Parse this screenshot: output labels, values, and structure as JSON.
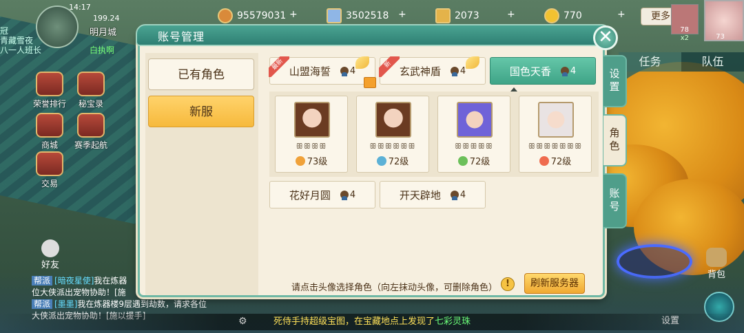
{
  "status": {
    "time": "14:17",
    "distance": "199.24",
    "city": "明月城"
  },
  "side_names": [
    "冠",
    "青藏雪夜",
    "八一人班长"
  ],
  "side_green": "白执啊",
  "resources": [
    {
      "icon": "copper-coin-icon",
      "value": "95579031",
      "color": "#d98a3a"
    },
    {
      "icon": "silver-note-icon",
      "value": "3502518",
      "color": "#8fb6e6"
    },
    {
      "icon": "gold-scroll-icon",
      "value": "2073",
      "color": "#e4b34a"
    },
    {
      "icon": "gold-ingot-icon",
      "value": "770",
      "color": "#f2c231"
    }
  ],
  "more_label": "更多",
  "levels": {
    "small": "78",
    "large": "73",
    "x2": "x2"
  },
  "left_menu": [
    {
      "label": "荣誉排行",
      "icon": "honor-rank-icon"
    },
    {
      "label": "秘宝录",
      "icon": "treasure-book-icon"
    },
    {
      "label": "商城",
      "icon": "shop-icon"
    },
    {
      "label": "赛季起航",
      "icon": "season-icon"
    },
    {
      "label": "交易",
      "icon": "trade-icon"
    }
  ],
  "friend_label": "好友",
  "chat": [
    {
      "tag": "帮派",
      "name": "[暗夜星使]",
      "text": "我在炼器"
    },
    {
      "tag": "",
      "name": "",
      "text": "位大侠派出宠物协助！[施"
    },
    {
      "tag": "帮派",
      "name": "[墨墨]",
      "text": "我在炼器楼9层遇到劫数，请求各位"
    },
    {
      "tag": "",
      "name": "",
      "text": "大侠派出宠物协助！[施以援手]"
    }
  ],
  "task_tabs": [
    "任务",
    "队伍"
  ],
  "bag_label": "背包",
  "settings_label": "设置",
  "announcement": {
    "main": "死侍手持超级宝图，在宝藏地点上发现了",
    "highlight": "七彩灵珠"
  },
  "dialog": {
    "title": "账号管理",
    "left_buttons": [
      "已有角色",
      "新服"
    ],
    "servers_row1": [
      {
        "name": "山盟海誓",
        "count": "4",
        "badge": "最新",
        "active": false
      },
      {
        "name": "玄武神盾",
        "count": "4",
        "badge": "新",
        "active": false
      },
      {
        "name": "国色天香",
        "count": "4",
        "badge": "",
        "active": true
      }
    ],
    "servers_row2": [
      {
        "name": "花好月圆",
        "count": "4"
      },
      {
        "name": "开天辟地",
        "count": "4"
      }
    ],
    "roles": [
      {
        "dots": "ꕥꕥꕥꕥ",
        "level": "73级",
        "sect_color": "#f0a23a"
      },
      {
        "dots": "ꕥꕥꕥꕥꕥꕥ",
        "level": "72级",
        "sect_color": "#5cb1d6"
      },
      {
        "dots": "ꕥꕥꕥꕥꕥ",
        "level": "72级",
        "sect_color": "#6cc05a"
      },
      {
        "dots": "ꕥꕥꕥꕥꕥꕥꕥ",
        "level": "72级",
        "sect_color": "#ef6b4e"
      }
    ],
    "hint": "请点击头像选择角色（向左抹动头像，可删除角色）",
    "refresh_label": "刷新服务器",
    "side_tabs": [
      "设置",
      "角色",
      "账号"
    ]
  }
}
